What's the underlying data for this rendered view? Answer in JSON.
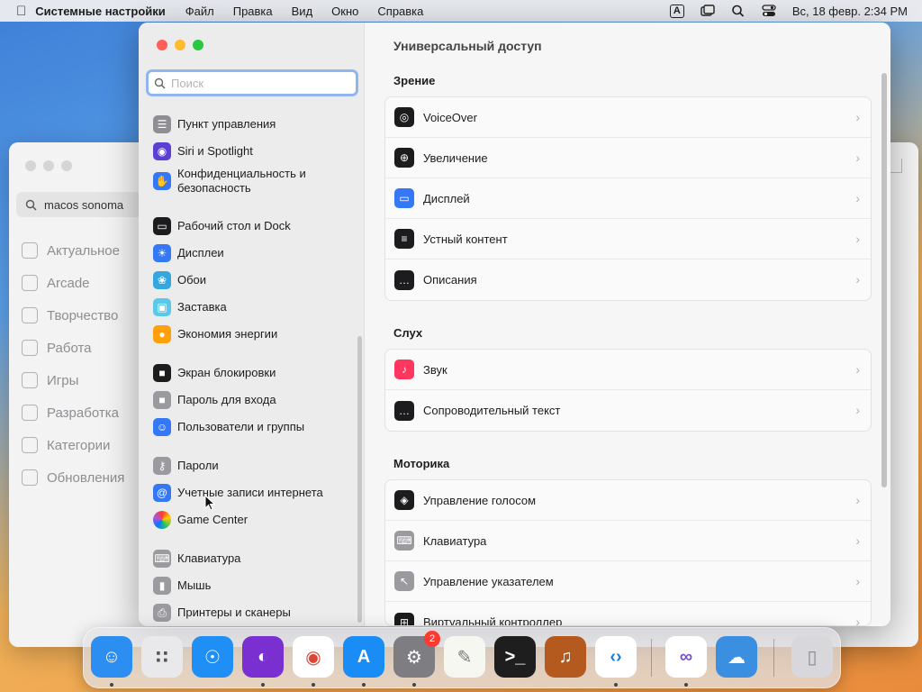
{
  "menubar": {
    "app_name": "Системные настройки",
    "menus": [
      "Файл",
      "Правка",
      "Вид",
      "Окно",
      "Справка"
    ],
    "input_indicator": "A",
    "datetime": "Вс, 18 февр.  2:34 PM"
  },
  "background_window": {
    "search_value": "macos sonoma",
    "nav": [
      {
        "label": "Актуальное",
        "icon": "star-icon"
      },
      {
        "label": "Arcade",
        "icon": "joystick-icon"
      },
      {
        "label": "Творчество",
        "icon": "brush-icon"
      },
      {
        "label": "Работа",
        "icon": "paper-plane-icon"
      },
      {
        "label": "Игры",
        "icon": "rocket-icon"
      },
      {
        "label": "Разработка",
        "icon": "hammer-icon"
      },
      {
        "label": "Категории",
        "icon": "grid-icon"
      },
      {
        "label": "Обновления",
        "icon": "download-icon"
      }
    ]
  },
  "sidebar": {
    "search_placeholder": "Поиск",
    "items": [
      {
        "label": "Пункт управления",
        "icon": "control-center-icon",
        "color": "#8e8e93"
      },
      {
        "label": "Siri и Spotlight",
        "icon": "siri-icon",
        "color": "#5e3fd6"
      },
      {
        "label": "Конфиденциальность и безопасность",
        "icon": "hand-icon",
        "color": "#3478f6"
      },
      {
        "label": "Рабочий стол и Dock",
        "icon": "dock-icon",
        "color": "#1c1c1e"
      },
      {
        "label": "Дисплеи",
        "icon": "sun-icon",
        "color": "#3478f6"
      },
      {
        "label": "Обои",
        "icon": "flower-icon",
        "color": "#34a7e0"
      },
      {
        "label": "Заставка",
        "icon": "screensaver-icon",
        "color": "#5ac8e8"
      },
      {
        "label": "Экономия энергии",
        "icon": "bulb-icon",
        "color": "#ff9f0a"
      },
      {
        "label": "Экран блокировки",
        "icon": "lock-icon",
        "color": "#1c1c1e"
      },
      {
        "label": "Пароль для входа",
        "icon": "padlock-icon",
        "color": "#9a9a9f"
      },
      {
        "label": "Пользователи и группы",
        "icon": "users-icon",
        "color": "#3478f6"
      },
      {
        "label": "Пароли",
        "icon": "key-icon",
        "color": "#9a9a9f"
      },
      {
        "label": "Учетные записи интернета",
        "icon": "at-icon",
        "color": "#3478f6"
      },
      {
        "label": "Game Center",
        "icon": "game-center-icon",
        "color": "#f2f2f2"
      },
      {
        "label": "Клавиатура",
        "icon": "keyboard-icon",
        "color": "#9a9a9f"
      },
      {
        "label": "Мышь",
        "icon": "mouse-icon",
        "color": "#9a9a9f"
      },
      {
        "label": "Принтеры и сканеры",
        "icon": "printer-icon",
        "color": "#9a9a9f"
      }
    ]
  },
  "content": {
    "title": "Универсальный доступ",
    "sections": [
      {
        "title": "Зрение",
        "rows": [
          {
            "label": "VoiceOver",
            "icon": "voiceover-icon",
            "color": "#1c1c1e"
          },
          {
            "label": "Увеличение",
            "icon": "zoom-icon",
            "color": "#1c1c1e"
          },
          {
            "label": "Дисплей",
            "icon": "display-icon",
            "color": "#3478f6"
          },
          {
            "label": "Устный контент",
            "icon": "speech-icon",
            "color": "#1c1c1e"
          },
          {
            "label": "Описания",
            "icon": "descriptions-icon",
            "color": "#1c1c1e"
          }
        ]
      },
      {
        "title": "Слух",
        "rows": [
          {
            "label": "Звук",
            "icon": "speaker-icon",
            "color": "#ff375f"
          },
          {
            "label": "Сопроводительный текст",
            "icon": "captions-icon",
            "color": "#1c1c1e"
          }
        ]
      },
      {
        "title": "Моторика",
        "rows": [
          {
            "label": "Управление голосом",
            "icon": "voice-control-icon",
            "color": "#1c1c1e"
          },
          {
            "label": "Клавиатура",
            "icon": "keyboard-icon",
            "color": "#9a9a9f"
          },
          {
            "label": "Управление указателем",
            "icon": "pointer-icon",
            "color": "#9a9a9f"
          },
          {
            "label": "Виртуальный контроллер",
            "icon": "switch-control-icon",
            "color": "#1c1c1e"
          }
        ]
      }
    ]
  },
  "dock": {
    "apps": [
      {
        "name": "finder-icon",
        "color": "#2b8ef0",
        "running": true
      },
      {
        "name": "launchpad-icon",
        "color": "#e9e9ec",
        "running": false
      },
      {
        "name": "safari-icon",
        "color": "#1f8ff5",
        "running": false
      },
      {
        "name": "firefox-icon",
        "color": "#7a2fd0",
        "running": true
      },
      {
        "name": "chrome-icon",
        "color": "#ffffff",
        "running": true
      },
      {
        "name": "app-store-icon",
        "color": "#1a8cf5",
        "running": true
      },
      {
        "name": "system-settings-icon",
        "color": "#7d7d82",
        "running": true,
        "badge": "2"
      },
      {
        "name": "textedit-icon",
        "color": "#f7f7f2",
        "running": false
      },
      {
        "name": "terminal-icon",
        "color": "#1e1e1e",
        "running": false
      },
      {
        "name": "instruments-icon",
        "color": "#b55a1f",
        "running": false
      },
      {
        "name": "vscode-icon",
        "color": "#ffffff",
        "running": true
      },
      {
        "name": "visual-studio-icon",
        "color": "#ffffff",
        "running": true
      },
      {
        "name": "weather-icon",
        "color": "#3a8fe0",
        "running": false
      },
      {
        "name": "trash-icon",
        "color": "#d8d8dc",
        "running": false
      }
    ]
  }
}
